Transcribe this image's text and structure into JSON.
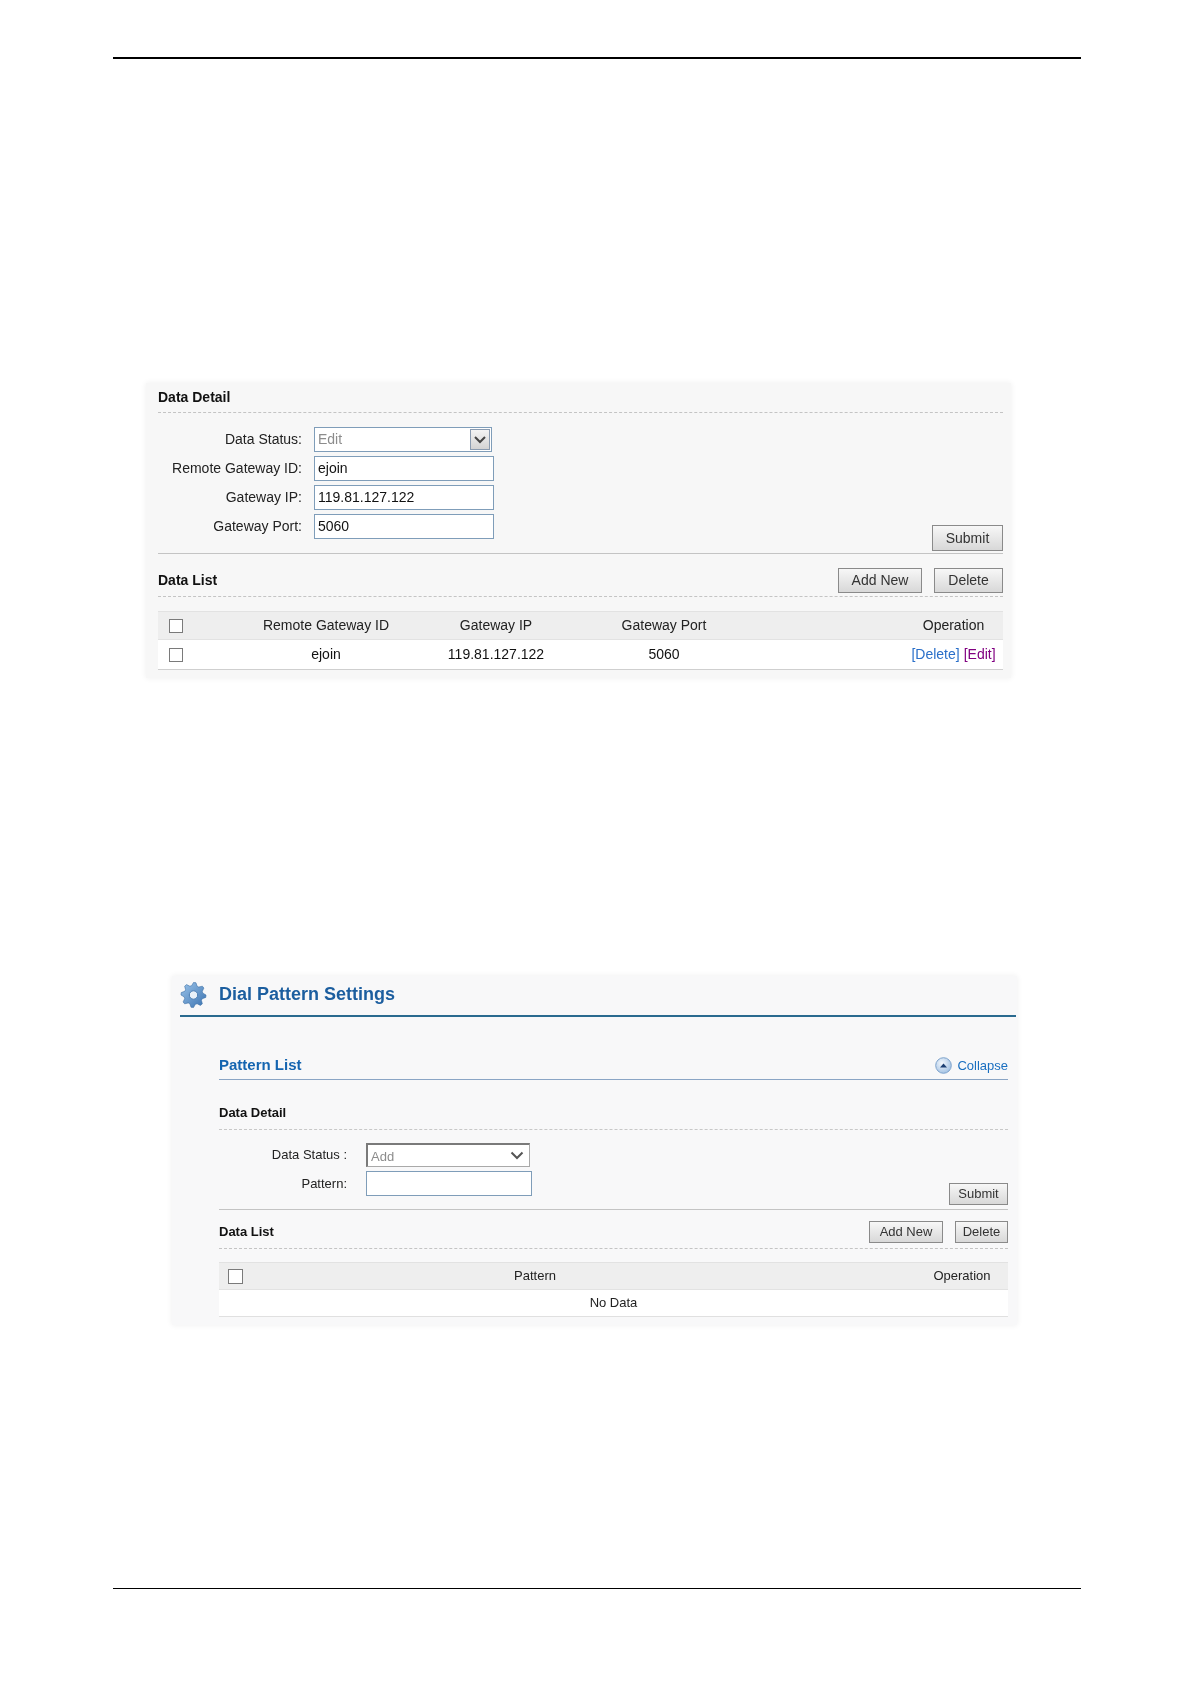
{
  "gateway_panel": {
    "data_detail": {
      "title": "Data Detail",
      "fields": [
        {
          "kind": "select",
          "label": "Data Status:",
          "value": "Edit",
          "disabled": true
        },
        {
          "kind": "text",
          "label": "Remote Gateway ID:",
          "value": "ejoin",
          "disabled": false
        },
        {
          "kind": "text",
          "label": "Gateway IP:",
          "value": "119.81.127.122",
          "disabled": false
        },
        {
          "kind": "text",
          "label": "Gateway Port:",
          "value": "5060",
          "disabled": false
        }
      ],
      "submit": "Submit"
    },
    "data_list": {
      "title": "Data List",
      "buttons": [
        "Add New",
        "Delete"
      ],
      "select_all": {
        "checked": false
      },
      "columns": [
        "Remote Gateway ID",
        "Gateway IP",
        "Gateway Port",
        "Operation"
      ],
      "rows": [
        {
          "checked": false,
          "cells": [
            "ejoin",
            "119.81.127.122",
            "5060"
          ],
          "links": [
            {
              "label": "[Delete]",
              "visited": false
            },
            {
              "label": "[Edit]",
              "visited": true
            }
          ]
        }
      ]
    }
  },
  "dial_pattern_panel": {
    "title": "Dial Pattern Settings",
    "section": {
      "title": "Pattern List",
      "collapse": "Collapse",
      "data_detail": {
        "title": "Data Detail",
        "fields": [
          {
            "kind": "select",
            "label": "Data Status :",
            "value": "Add",
            "disabled": true
          },
          {
            "kind": "text",
            "label": "Pattern:",
            "disabled": false
          }
        ],
        "submit": "Submit"
      },
      "data_list": {
        "title": "Data List",
        "buttons": [
          "Add New",
          "Delete"
        ],
        "select_all": {
          "checked": false
        },
        "columns": [
          "Pattern",
          "Operation"
        ],
        "empty_message": "No Data"
      }
    }
  }
}
